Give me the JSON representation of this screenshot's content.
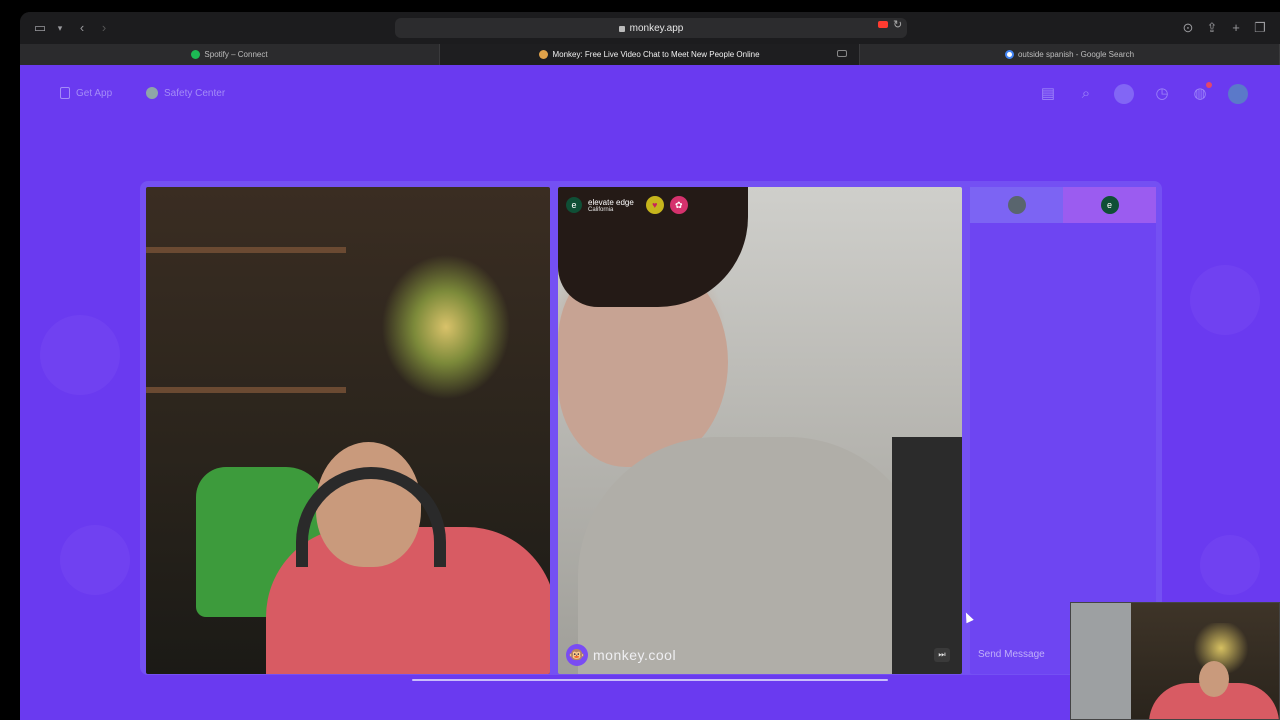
{
  "browser": {
    "address": "monkey.app",
    "tabs": [
      {
        "label": "Spotify – Connect"
      },
      {
        "label": "Monkey: Free Live Video Chat to Meet New People Online"
      },
      {
        "label": "outside spanish - Google Search"
      }
    ]
  },
  "nav": {
    "get_app": "Get App",
    "safety_center": "Safety Center"
  },
  "peer": {
    "initial": "e",
    "name": "elevate edge",
    "location": "California"
  },
  "brand": {
    "watermark": "monkey.cool"
  },
  "chat": {
    "peer_initial": "e",
    "placeholder": "Send Message"
  },
  "colors": {
    "page_bg": "#6a3af0",
    "stage_bg": "#7450f3",
    "chat_bg": "#6e45f2",
    "recording": "#ff3b30"
  }
}
